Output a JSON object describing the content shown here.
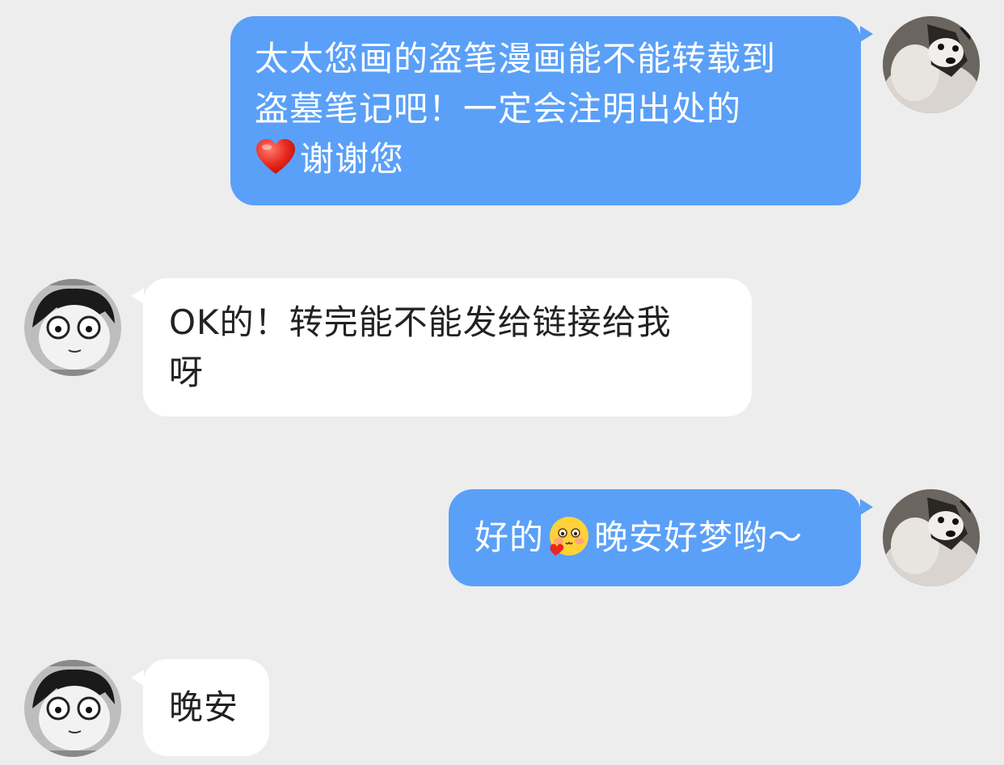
{
  "messages": [
    {
      "side": "outgoing",
      "lines": [
        "太太您画的盗笔漫画能不能转载到",
        "盗墓笔记吧！一定会注明出处的"
      ],
      "line3_emoji": "red-heart",
      "line3_text": "谢谢您"
    },
    {
      "side": "incoming",
      "lines": [
        "OK的！转完能不能发给链接给我",
        "呀"
      ]
    },
    {
      "side": "outgoing",
      "text_before": "好的",
      "emoji": "blushing-face-with-heart",
      "text_after": "晚安好梦哟～"
    },
    {
      "side": "incoming",
      "lines": [
        "晚安"
      ]
    }
  ],
  "avatars": {
    "me": "husky-dog-avatar",
    "peer": "manga-boy-avatar"
  },
  "colors": {
    "background": "#ededed",
    "outgoing_bubble": "#5aa0f8",
    "incoming_bubble": "#ffffff",
    "outgoing_text": "#ffffff",
    "incoming_text": "#222222"
  }
}
